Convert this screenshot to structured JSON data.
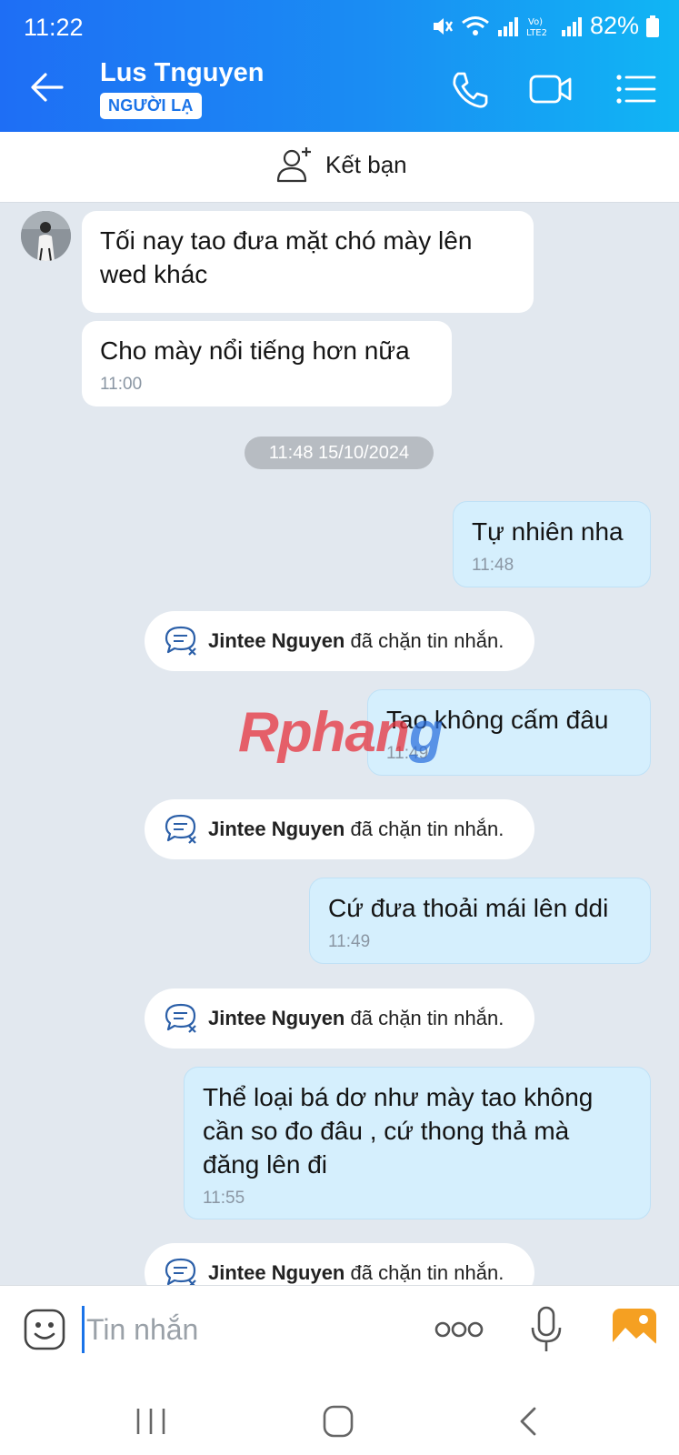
{
  "status_bar": {
    "time": "11:22",
    "battery": "82%"
  },
  "header": {
    "contact_name": "Lus Tnguyen",
    "badge": "NGƯỜI LẠ"
  },
  "friend_bar": {
    "label": "Kết bạn"
  },
  "messages": {
    "m1": {
      "text": "Tối nay tao đưa mặt chó mày lên wed khác"
    },
    "m2": {
      "text": "Cho mày nổi tiếng hơn nữa",
      "time": "11:00"
    },
    "date_divider": "11:48 15/10/2024",
    "m3": {
      "text": "Tự nhiên nha",
      "time": "11:48"
    },
    "m4": {
      "text": "Tao không cấm đâu",
      "time": "11:49"
    },
    "m5": {
      "text": "Cứ đưa thoải mái lên ddi",
      "time": "11:49"
    },
    "m6": {
      "text": "Thể loại bá dơ như mày tao không cần so đo đâu , cứ thong thả mà đăng lên đi",
      "time": "11:55"
    }
  },
  "system_notice": {
    "name": "Jintee Nguyen",
    "text": "đã chặn tin nhắn."
  },
  "watermark": {
    "part1": "Rphan",
    "part2": "g"
  },
  "input": {
    "placeholder": "Tin nhắn"
  },
  "colors": {
    "header_start": "#1e6ef5",
    "header_end": "#10b6f4",
    "outgoing_bubble": "#d5effd",
    "chat_bg": "#e2e8ef"
  }
}
